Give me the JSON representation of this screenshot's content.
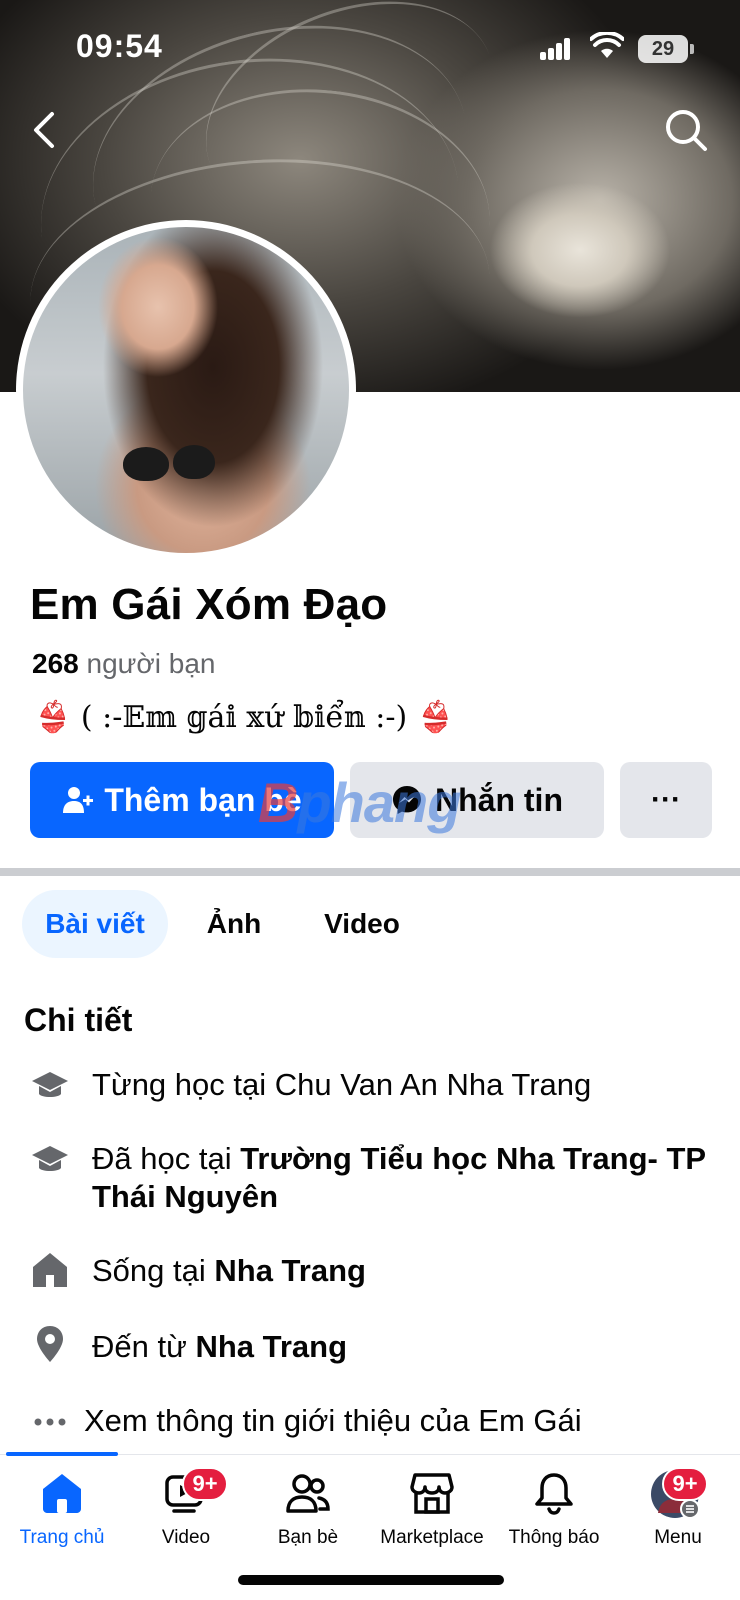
{
  "status": {
    "time": "09:54",
    "battery": "29"
  },
  "profile": {
    "name": "Em Gái Xóm Đạo",
    "friends_count": "268",
    "friends_label": "người bạn",
    "bio_emoji_left": "👙",
    "bio_text": " ( :-𝔼𝕞 𝕘á𝕚 𝕩ứ 𝕓𝕚ể𝕟  :-) ",
    "bio_emoji_right": "👙"
  },
  "actions": {
    "add_friend": "Thêm bạn bè",
    "message": "Nhắn tin",
    "more": "···"
  },
  "watermark": {
    "first": "B",
    "rest": "phang"
  },
  "tabs": [
    {
      "label": "Bài viết",
      "active": true
    },
    {
      "label": "Ảnh",
      "active": false
    },
    {
      "label": "Video",
      "active": false
    }
  ],
  "details": {
    "title": "Chi tiết",
    "items": [
      {
        "icon": "graduation-cap-icon",
        "prefix": "Từng học tại Chu Van An Nha Trang",
        "bold": ""
      },
      {
        "icon": "graduation-cap-icon",
        "prefix": "Đã học tại ",
        "bold": "Trường Tiểu học Nha Trang- TP Thái Nguyên"
      },
      {
        "icon": "home-icon",
        "prefix": "Sống tại ",
        "bold": "Nha Trang"
      },
      {
        "icon": "location-pin-icon",
        "prefix": "Đến từ ",
        "bold": "Nha Trang"
      }
    ],
    "see_more": "Xem thông tin giới thiệu của Em Gái"
  },
  "nav": [
    {
      "label": "Trang chủ",
      "icon": "home-icon",
      "active": true,
      "badge": ""
    },
    {
      "label": "Video",
      "icon": "video-icon",
      "active": false,
      "badge": "9+"
    },
    {
      "label": "Bạn bè",
      "icon": "friends-icon",
      "active": false,
      "badge": ""
    },
    {
      "label": "Marketplace",
      "icon": "marketplace-icon",
      "active": false,
      "badge": ""
    },
    {
      "label": "Thông báo",
      "icon": "bell-icon",
      "active": false,
      "badge": ""
    },
    {
      "label": "Menu",
      "icon": "avatar-icon",
      "active": false,
      "badge": "9+"
    }
  ],
  "colors": {
    "accent": "#0866ff",
    "badge": "#e41e3f",
    "button_gray": "#e4e6eb",
    "secondary_text": "#65676b"
  }
}
